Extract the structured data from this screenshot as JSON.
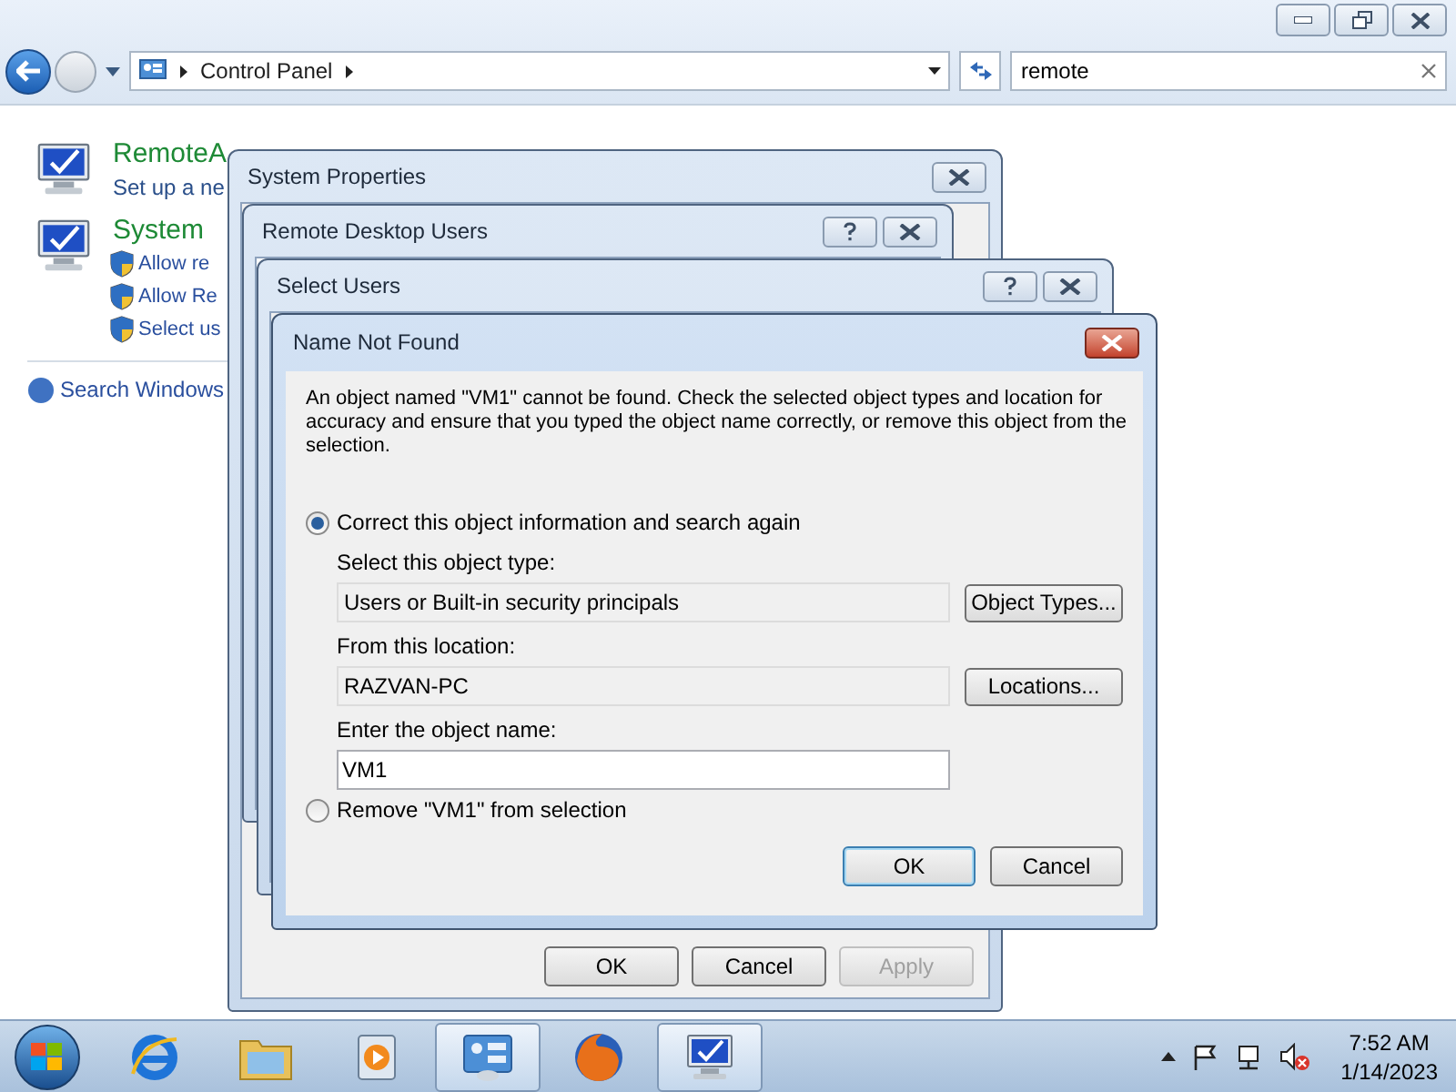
{
  "explorer": {
    "address": {
      "crumbs": [
        "Control Panel"
      ]
    },
    "search": {
      "value": "remote"
    },
    "results": [
      {
        "title": "RemoteA",
        "subtitle": "Set up a ne"
      },
      {
        "title": "System",
        "links": [
          "Allow re",
          "Allow Re",
          "Select us"
        ]
      }
    ],
    "help_link": "Search Windows"
  },
  "dialogs": [
    {
      "title": "System Properties",
      "help": false,
      "buttons": [
        {
          "label": "OK",
          "disabled": false
        },
        {
          "label": "Cancel",
          "disabled": false
        },
        {
          "label": "Apply",
          "disabled": true
        }
      ]
    },
    {
      "title": "Remote Desktop Users",
      "help": true
    },
    {
      "title": "Select Users",
      "help": true
    }
  ],
  "name_not_found": {
    "title": "Name Not Found",
    "message": "An object named \"VM1\" cannot be found. Check the selected object types and location for accuracy and ensure that you typed the object name correctly, or remove this object from the selection.",
    "options": [
      {
        "label": "Correct this object information and search again",
        "selected": true
      },
      {
        "label": "Remove \"VM1\" from selection",
        "selected": false
      }
    ],
    "object_type": {
      "label": "Select this object type:",
      "value": "Users or Built-in security principals",
      "button": "Object Types..."
    },
    "location": {
      "label": "From this location:",
      "value": "RAZVAN-PC",
      "button": "Locations..."
    },
    "object_name": {
      "label": "Enter the object name:",
      "value": "VM1"
    },
    "buttons": [
      {
        "label": "OK",
        "default": true
      },
      {
        "label": "Cancel",
        "default": false
      }
    ]
  },
  "taskbar": {
    "apps": [
      {
        "kind": "browser-e",
        "selected": false
      },
      {
        "kind": "folder",
        "selected": false
      },
      {
        "kind": "media",
        "selected": false
      },
      {
        "kind": "control-panel",
        "selected": true
      },
      {
        "kind": "fox",
        "selected": false
      },
      {
        "kind": "monitor",
        "selected": true
      }
    ],
    "clock": {
      "time": "7:52 AM",
      "date": "1/14/2023"
    }
  }
}
